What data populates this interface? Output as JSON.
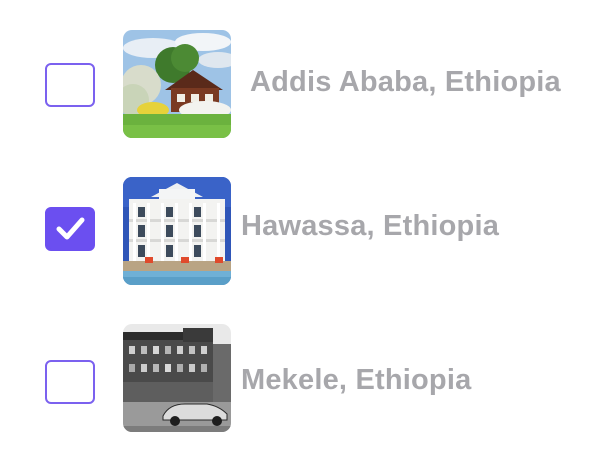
{
  "options": [
    {
      "label": "Addis Ababa, Ethiopia",
      "checked": false,
      "image_icon": "house-countryside-photo"
    },
    {
      "label": "Hawassa, Ethiopia",
      "checked": true,
      "image_icon": "white-mansion-photo"
    },
    {
      "label": "Mekele, Ethiopia",
      "checked": false,
      "image_icon": "old-street-bw-photo"
    }
  ],
  "colors": {
    "accent": "#6b4ff0",
    "checkbox_border": "#7b61ef",
    "label_text": "#a7a7ab"
  }
}
